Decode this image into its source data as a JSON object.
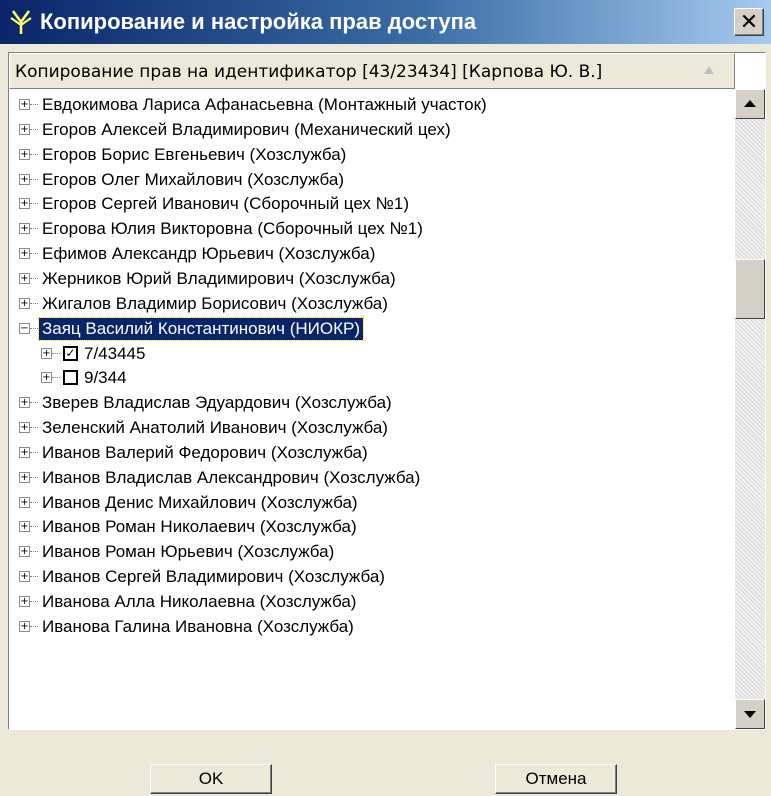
{
  "window": {
    "title": "Копирование и настройка прав доступа",
    "close_label": "✕"
  },
  "list": {
    "header": "Копирование прав на идентификатор [43/23434] [Карпова Ю. В.]"
  },
  "tree_rows": [
    {
      "label": "Евдокимова Лариса Афанасьевна (Монтажный участок)",
      "expander": "+"
    },
    {
      "label": "Егоров Алексей Владимирович (Механический цех)",
      "expander": "+"
    },
    {
      "label": "Егоров Борис Евгеньевич (Хозслужба)",
      "expander": "+"
    },
    {
      "label": "Егоров Олег Михайлович (Хозслужба)",
      "expander": "+"
    },
    {
      "label": "Егоров Сергей Иванович (Сборочный цех №1)",
      "expander": "+"
    },
    {
      "label": "Егорова Юлия Викторовна (Сборочный цех №1)",
      "expander": "+"
    },
    {
      "label": "Ефимов Александр Юрьевич (Хозслужба)",
      "expander": "+"
    },
    {
      "label": "Жерников Юрий Владимирович (Хозслужба)",
      "expander": "+"
    },
    {
      "label": "Жигалов Владимир Борисович (Хозслужба)",
      "expander": "+"
    },
    {
      "label": "Заяц Василий Константинович (НИОКР)",
      "expander": "−",
      "selected": true
    },
    {
      "label": "7/43445",
      "expander": "+",
      "child": true,
      "checked": true
    },
    {
      "label": "9/344",
      "expander": "+",
      "child": true,
      "checked": false
    },
    {
      "label": "Зверев Владислав Эдуардович (Хозслужба)",
      "expander": "+"
    },
    {
      "label": "Зеленский Анатолий Иванович (Хозслужба)",
      "expander": "+"
    },
    {
      "label": "Иванов Валерий Федорович (Хозслужба)",
      "expander": "+"
    },
    {
      "label": "Иванов Владислав Александрович (Хозслужба)",
      "expander": "+"
    },
    {
      "label": "Иванов Денис Михайлович (Хозслужба)",
      "expander": "+"
    },
    {
      "label": "Иванов Роман Николаевич (Хозслужба)",
      "expander": "+"
    },
    {
      "label": "Иванов Роман Юрьевич (Хозслужба)",
      "expander": "+"
    },
    {
      "label": "Иванов Сергей Владимирович (Хозслужба)",
      "expander": "+"
    },
    {
      "label": "Иванова Алла Николаевна (Хозслужба)",
      "expander": "+"
    },
    {
      "label": "Иванова Галина Ивановна (Хозслужба)",
      "expander": "+"
    }
  ],
  "buttons": {
    "ok": "OK",
    "cancel": "Отмена"
  },
  "colors": {
    "selection": "#0a246a",
    "title_gradient_start": "#0a246a",
    "title_gradient_end": "#a6caf0",
    "dialog_bg": "#ece9d8"
  },
  "icons": {
    "title": "antenna-icon",
    "sort": "sort-up-icon"
  }
}
